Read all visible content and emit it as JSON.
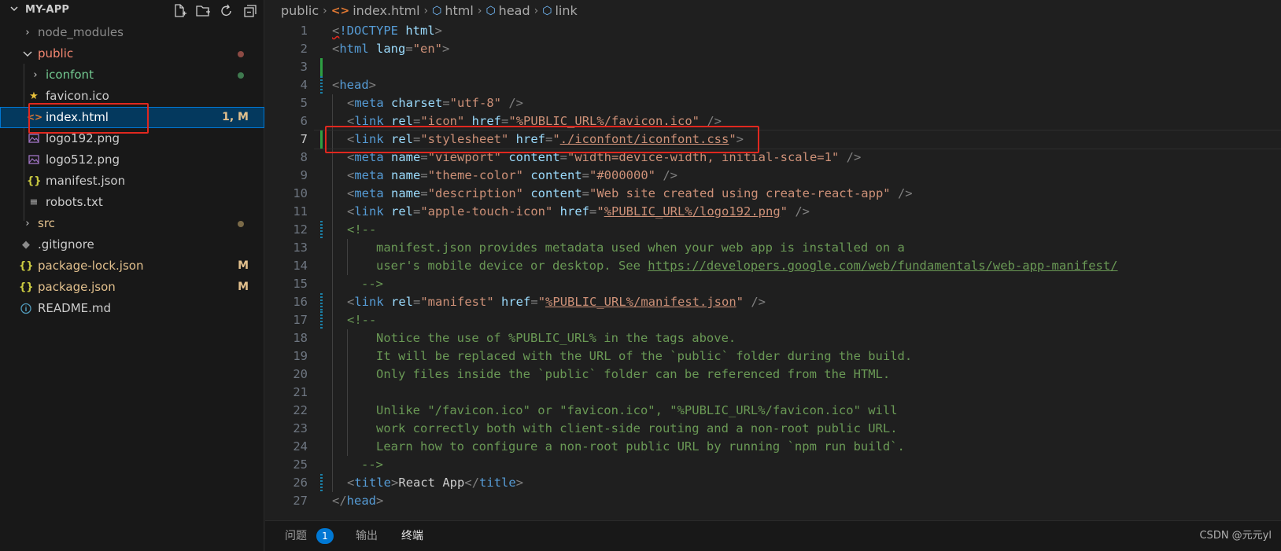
{
  "explorer": {
    "title": "MY-APP",
    "items": [
      {
        "label": "node_modules",
        "icon": "chevron-right-icon"
      },
      {
        "label": "public",
        "icon": "chevron-down-icon"
      },
      {
        "label": "iconfont",
        "icon": "chevron-right-icon"
      },
      {
        "label": "favicon.ico",
        "icon": "star-icon"
      },
      {
        "label": "index.html",
        "icon": "html-file-icon",
        "badge": "1, M"
      },
      {
        "label": "logo192.png",
        "icon": "image-file-icon"
      },
      {
        "label": "logo512.png",
        "icon": "image-file-icon"
      },
      {
        "label": "manifest.json",
        "icon": "json-file-icon"
      },
      {
        "label": "robots.txt",
        "icon": "text-file-icon"
      },
      {
        "label": "src",
        "icon": "chevron-right-icon"
      },
      {
        "label": ".gitignore",
        "icon": "git-icon"
      },
      {
        "label": "package-lock.json",
        "icon": "json-file-icon",
        "badge": "M"
      },
      {
        "label": "package.json",
        "icon": "json-file-icon",
        "badge": "M"
      },
      {
        "label": "README.md",
        "icon": "info-icon"
      }
    ]
  },
  "breadcrumb": {
    "c0": "public",
    "c1": "index.html",
    "c2": "html",
    "c3": "head",
    "c4": "link"
  },
  "code": {
    "line_numbers": [
      "1",
      "2",
      "3",
      "4",
      "5",
      "6",
      "7",
      "8",
      "9",
      "10",
      "11",
      "12",
      "13",
      "14",
      "15",
      "16",
      "17",
      "18",
      "19",
      "20",
      "21",
      "22",
      "23",
      "24",
      "25",
      "26",
      "27"
    ],
    "active_line": 7,
    "l1": {
      "a": "<",
      "b": "!DOCTYPE",
      "c": " html",
      "d": ">"
    },
    "l2": {
      "a": "<",
      "b": "html",
      "c": " lang",
      "d": "=",
      "e": "\"en\"",
      "f": ">"
    },
    "l4": {
      "a": "<",
      "b": "head",
      "c": ">"
    },
    "l5": {
      "a": "<",
      "b": "meta",
      "c": " charset",
      "d": "=",
      "e": "\"utf-8\"",
      "f": " />"
    },
    "l6": {
      "a": "<",
      "b": "link",
      "c": " rel",
      "d": "=",
      "e": "\"icon\"",
      "f": " href",
      "g": "=",
      "h": "\"",
      "i": "%PUBLIC_URL%/favicon.ico",
      "j": "\"",
      "k": " />"
    },
    "l7": {
      "a": "<",
      "b": "link",
      "c": " rel",
      "d": "=",
      "e": "\"stylesheet\"",
      "f": " href",
      "g": "=",
      "h": "\"",
      "i": "./iconfont/iconfont.css",
      "j": "\"",
      "k": ">"
    },
    "l8": {
      "a": "<",
      "b": "meta",
      "c": " name",
      "d": "=",
      "e": "\"viewport\"",
      "f": " content",
      "g": "=",
      "h": "\"width=device-width, initial-scale=1\"",
      "i": " />"
    },
    "l9": {
      "a": "<",
      "b": "meta",
      "c": " name",
      "d": "=",
      "e": "\"theme-color\"",
      "f": " content",
      "g": "=",
      "h": "\"#000000\"",
      "i": " />"
    },
    "l10": {
      "a": "<",
      "b": "meta",
      "c": " name",
      "d": "=",
      "e": "\"description\"",
      "f": " content",
      "g": "=",
      "h": "\"Web site created using create-react-app\"",
      "i": " />"
    },
    "l11": {
      "a": "<",
      "b": "link",
      "c": " rel",
      "d": "=",
      "e": "\"apple-touch-icon\"",
      "f": " href",
      "g": "=",
      "h": "\"",
      "i": "%PUBLIC_URL%/logo192.png",
      "j": "\"",
      "k": " />"
    },
    "l12": "<!--",
    "l13": "manifest.json provides metadata used when your web app is installed on a",
    "l14a": "user's mobile device or desktop. See ",
    "l14b": "https://developers.google.com/web/fundamentals/web-app-manifest/",
    "l15": "-->",
    "l16": {
      "a": "<",
      "b": "link",
      "c": " rel",
      "d": "=",
      "e": "\"manifest\"",
      "f": " href",
      "g": "=",
      "h": "\"",
      "i": "%PUBLIC_URL%/manifest.json",
      "j": "\"",
      "k": " />"
    },
    "l17": "<!--",
    "l18": "Notice the use of %PUBLIC_URL% in the tags above.",
    "l19": "It will be replaced with the URL of the `public` folder during the build.",
    "l20": "Only files inside the `public` folder can be referenced from the HTML.",
    "l22": "Unlike \"/favicon.ico\" or \"favicon.ico\", \"%PUBLIC_URL%/favicon.ico\" will",
    "l23": "work correctly both with client-side routing and a non-root public URL.",
    "l24": "Learn how to configure a non-root public URL by running `npm run build`.",
    "l25": "-->",
    "l26": {
      "a": "<",
      "b": "title",
      "c": ">",
      "d": "React App",
      "e": "</",
      "f": "title",
      "g": ">"
    },
    "l27": {
      "a": "</",
      "b": "head",
      "c": ">"
    }
  },
  "panel": {
    "tab_problems": "问题",
    "problems_count": "1",
    "tab_output": "输出",
    "tab_terminal": "终端",
    "watermark": "CSDN @元元yl"
  },
  "colors": {
    "accent": "#0078d4",
    "highlight_box": "#e0281f",
    "modified": "#e2c08d",
    "untracked": "#73c991",
    "folder_error": "#f48771"
  }
}
